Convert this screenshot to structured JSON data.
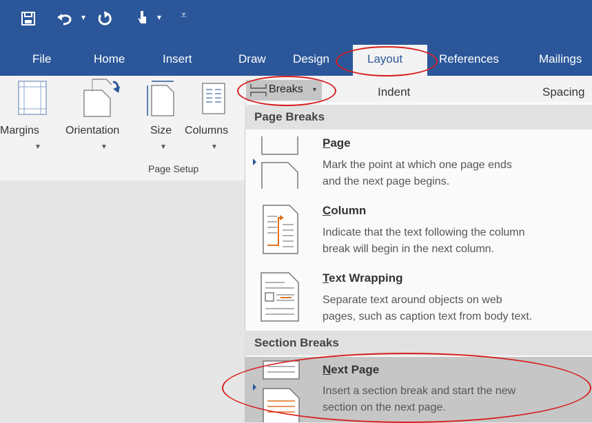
{
  "tabs": [
    "File",
    "Home",
    "Insert",
    "Draw",
    "Design",
    "Layout",
    "References",
    "Mailings"
  ],
  "active_tab": "Layout",
  "ribbon": {
    "margins": "Margins",
    "orientation": "Orientation",
    "size": "Size",
    "columns": "Columns",
    "group_label": "Page Setup",
    "breaks": "Breaks",
    "indent": "Indent",
    "spacing": "Spacing"
  },
  "menu": {
    "page_breaks_header": "Page Breaks",
    "section_breaks_header": "Section Breaks",
    "items": [
      {
        "title_ul": "P",
        "title_rest": "age",
        "desc": "Mark the point at which one page ends\nand the next page begins."
      },
      {
        "title_ul": "C",
        "title_rest": "olumn",
        "desc": "Indicate that the text following the column\nbreak will begin in the next column."
      },
      {
        "title_ul": "T",
        "title_rest": "ext Wrapping",
        "desc": "Separate text around objects on web\npages, such as caption text from body text."
      },
      {
        "title_ul": "N",
        "title_rest": "ext Page",
        "desc": "Insert a section break and start the new\nsection on the next page."
      }
    ]
  },
  "colors": {
    "title_bar": "#2b579a",
    "annotation": "#d81e1e",
    "accent_orange": "#e07020"
  }
}
